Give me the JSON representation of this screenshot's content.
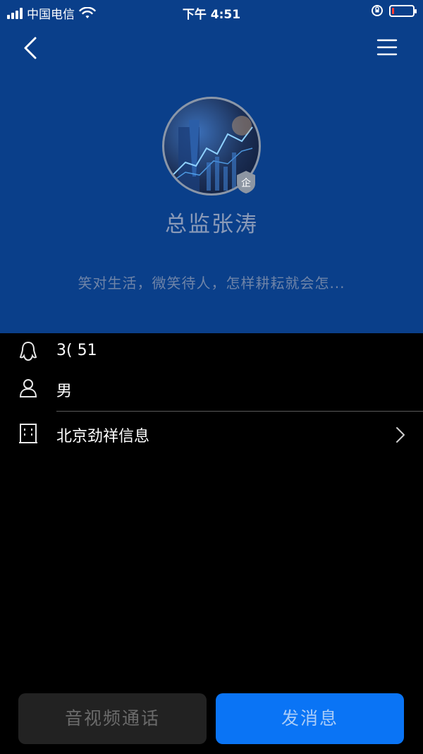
{
  "status_bar": {
    "carrier": "中国电信",
    "time": "下午 4:51",
    "icons": [
      "signal-icon",
      "wifi-icon",
      "rotation-lock-icon",
      "battery-icon"
    ],
    "battery_level": 0.1
  },
  "profile": {
    "name": "总监张涛",
    "badge": "企",
    "motto": "笑对生活，微笑待人，怎样耕耘就会怎..."
  },
  "info": {
    "qq_number": "3(                51",
    "gender": "男",
    "company": "北京劲祥信息"
  },
  "actions": {
    "av_call_label": "音视频通话",
    "message_label": "发消息"
  },
  "colors": {
    "header_bg": "#0a3f8a",
    "primary_button": "#0a74f5",
    "secondary_button": "#222222"
  }
}
